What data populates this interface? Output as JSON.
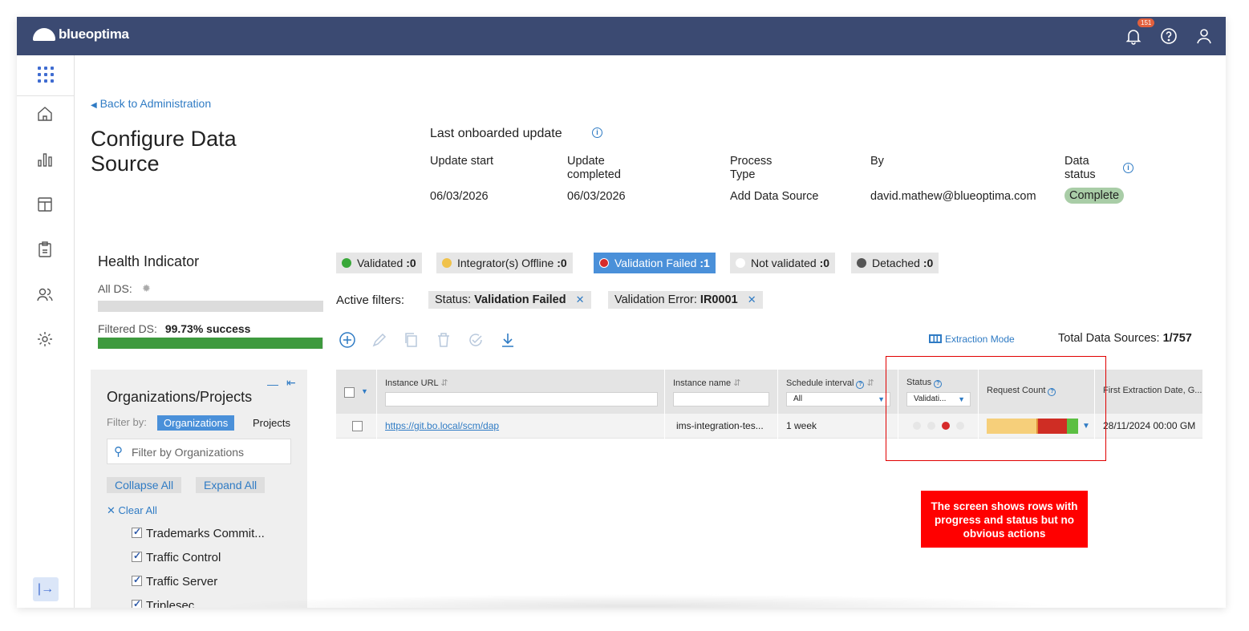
{
  "app": {
    "brand": "blueoptima",
    "notification_count": "151"
  },
  "nav": {
    "back_link": "Back to Administration",
    "page_title": "Configure Data Source"
  },
  "last_update": {
    "heading": "Last onboarded update",
    "columns": [
      {
        "label": "Update start",
        "value": "06/03/2026"
      },
      {
        "label": "Update completed",
        "value": "06/03/2026"
      },
      {
        "label": "Process Type",
        "value": "Add Data Source"
      },
      {
        "label": "By",
        "value": "david.mathew@blueoptima.com"
      },
      {
        "label": "Data status",
        "value": "Complete"
      }
    ]
  },
  "health": {
    "title": "Health Indicator",
    "all_ds_label": "All DS:",
    "filtered_ds_label": "Filtered DS:",
    "filtered_ds_value": "99.73% success",
    "filtered_ds_progress": 0.9973
  },
  "status_chips": [
    {
      "label": "Validated",
      "count": ":0",
      "color": "#3aa83a"
    },
    {
      "label": "Integrator(s) Offline",
      "count": ":0",
      "color": "#f0c24b"
    },
    {
      "label": "Validation Failed",
      "count": ":1",
      "color": "#d62a2a",
      "active": true
    },
    {
      "label": "Not validated",
      "count": ":0",
      "color": "#ffffff"
    },
    {
      "label": "Detached",
      "count": ":0",
      "color": "#555555"
    }
  ],
  "filters": {
    "label": "Active filters:",
    "items": [
      {
        "key": "Status:",
        "value": "Validation Failed"
      },
      {
        "key": "Validation Error:",
        "value": "IR0001"
      }
    ]
  },
  "toolbar": {
    "extraction_mode": "Extraction Mode",
    "total_label": "Total Data Sources:",
    "total_value": "1/757"
  },
  "org_panel": {
    "title": "Organizations/Projects",
    "filter_by": "Filter by:",
    "tab_orgs": "Organizations",
    "tab_projects": "Projects",
    "search_placeholder": "Filter by Organizations",
    "collapse_all": "Collapse All",
    "expand_all": "Expand All",
    "clear_all": "Clear All",
    "items": [
      "Trademarks Commit...",
      "Traffic Control",
      "Traffic Server",
      "Triplesec"
    ]
  },
  "table": {
    "headers": {
      "instance_url": "Instance URL",
      "instance_name": "Instance name",
      "schedule": "Schedule interval",
      "status": "Status",
      "request_count": "Request Count",
      "first_extraction": "First Extraction Date, G..."
    },
    "schedule_filter": "All",
    "status_filter": "Validati...",
    "rows": [
      {
        "url": "https://git.bo.local/scm/dap",
        "name": "ims-integration-tes...",
        "schedule": "1 week",
        "first_extraction": "28/11/2024 00:00 GM"
      }
    ],
    "request_count_segments": [
      {
        "fraction": 0.54,
        "color": "#f6cf7a"
      },
      {
        "fraction": 0.02,
        "color": "#e0903a"
      },
      {
        "fraction": 0.32,
        "color": "#cf2d24"
      },
      {
        "fraction": 0.12,
        "color": "#5cbf42"
      }
    ]
  },
  "callout": "The screen shows rows with progress and status but no obvious actions"
}
